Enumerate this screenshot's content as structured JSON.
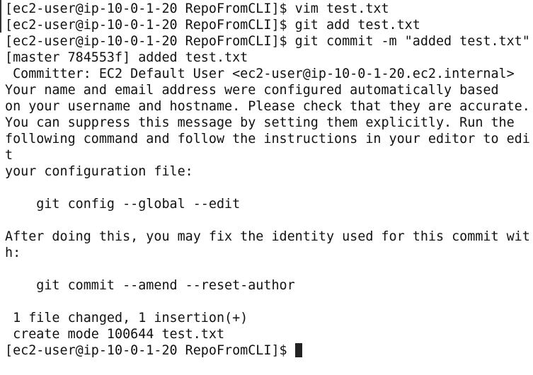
{
  "terminal": {
    "lines": [
      "[ec2-user@ip-10-0-1-20 RepoFromCLI]$ vim test.txt",
      "[ec2-user@ip-10-0-1-20 RepoFromCLI]$ git add test.txt",
      "[ec2-user@ip-10-0-1-20 RepoFromCLI]$ git commit -m \"added test.txt\"",
      "[master 784553f] added test.txt",
      " Committer: EC2 Default User <ec2-user@ip-10-0-1-20.ec2.internal>",
      "Your name and email address were configured automatically based",
      "on your username and hostname. Please check that they are accurate.",
      "You can suppress this message by setting them explicitly. Run the",
      "following command and follow the instructions in your editor to edi",
      "t",
      "your configuration file:",
      "",
      "    git config --global --edit",
      "",
      "After doing this, you may fix the identity used for this commit wit",
      "h:",
      "",
      "    git commit --amend --reset-author",
      "",
      " 1 file changed, 1 insertion(+)",
      " create mode 100644 test.txt"
    ],
    "prompt": "[ec2-user@ip-10-0-1-20 RepoFromCLI]$ "
  }
}
